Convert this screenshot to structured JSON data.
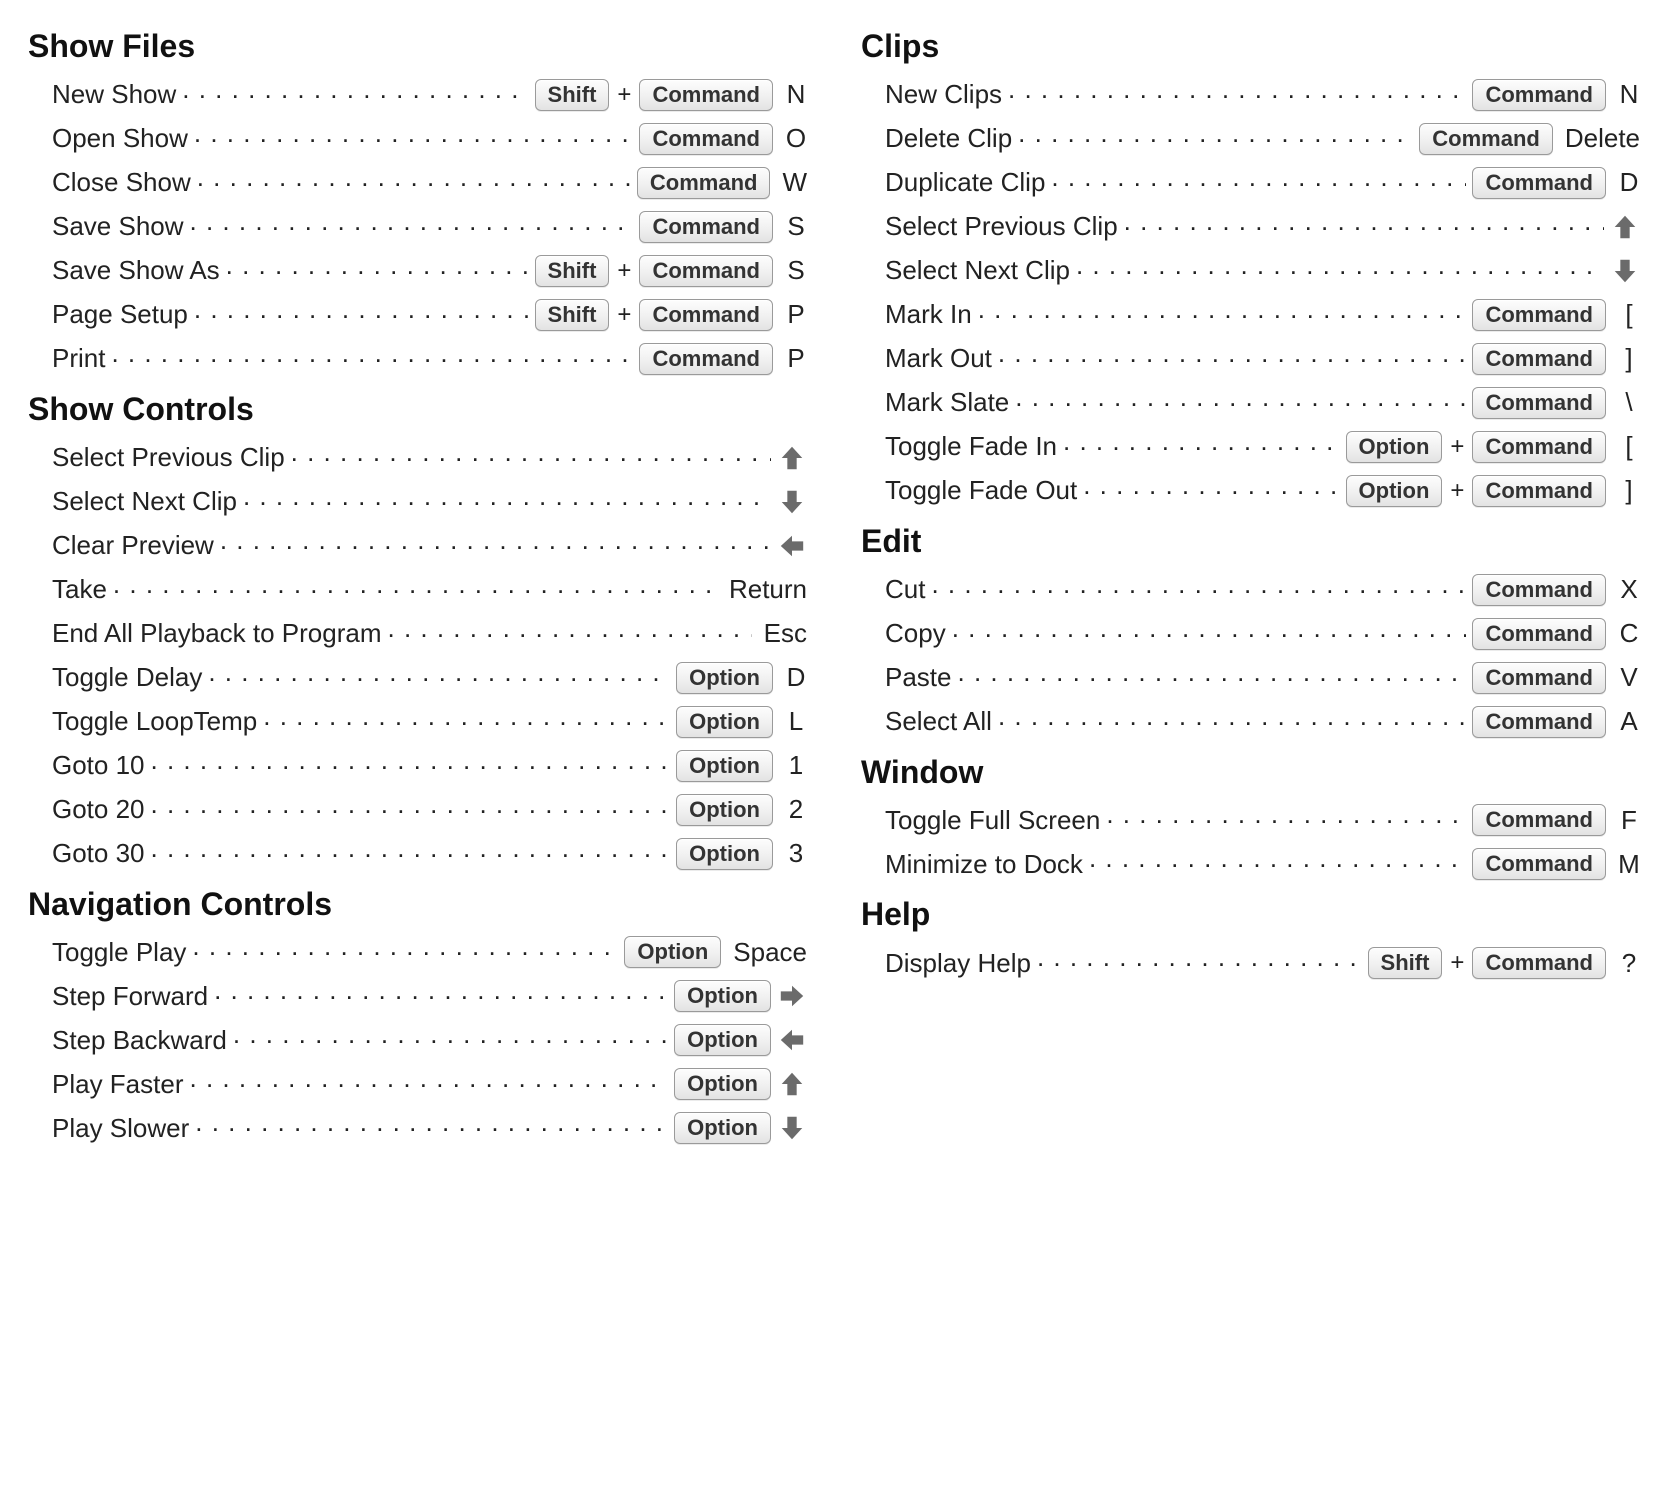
{
  "sections": [
    {
      "column": 0,
      "title": "Show Files",
      "rows": [
        {
          "label": "New Show",
          "keys": [
            {
              "t": "key",
              "v": "Shift"
            },
            {
              "t": "plus"
            },
            {
              "t": "key",
              "v": "Command"
            }
          ],
          "end": {
            "t": "text",
            "v": "N"
          }
        },
        {
          "label": "Open Show",
          "keys": [
            {
              "t": "key",
              "v": "Command"
            }
          ],
          "end": {
            "t": "text",
            "v": "O"
          }
        },
        {
          "label": "Close Show",
          "keys": [
            {
              "t": "key",
              "v": "Command"
            }
          ],
          "end": {
            "t": "text",
            "v": "W"
          }
        },
        {
          "label": "Save Show",
          "keys": [
            {
              "t": "key",
              "v": "Command"
            }
          ],
          "end": {
            "t": "text",
            "v": "S"
          }
        },
        {
          "label": "Save Show As",
          "keys": [
            {
              "t": "key",
              "v": "Shift"
            },
            {
              "t": "plus"
            },
            {
              "t": "key",
              "v": "Command"
            }
          ],
          "end": {
            "t": "text",
            "v": "S"
          }
        },
        {
          "label": "Page Setup",
          "keys": [
            {
              "t": "key",
              "v": "Shift"
            },
            {
              "t": "plus"
            },
            {
              "t": "key",
              "v": "Command"
            }
          ],
          "end": {
            "t": "text",
            "v": "P"
          }
        },
        {
          "label": "Print",
          "keys": [
            {
              "t": "key",
              "v": "Command"
            }
          ],
          "end": {
            "t": "text",
            "v": "P"
          }
        }
      ]
    },
    {
      "column": 0,
      "title": "Show Controls",
      "rows": [
        {
          "label": "Select Previous Clip",
          "keys": [],
          "end": {
            "t": "arrow",
            "v": "up"
          }
        },
        {
          "label": "Select Next Clip",
          "keys": [],
          "end": {
            "t": "arrow",
            "v": "down"
          }
        },
        {
          "label": "Clear Preview",
          "keys": [],
          "end": {
            "t": "arrow",
            "v": "left"
          }
        },
        {
          "label": "Take",
          "keys": [],
          "end": {
            "t": "text",
            "v": "Return"
          }
        },
        {
          "label": "End All Playback to Program",
          "keys": [],
          "end": {
            "t": "text",
            "v": "Esc"
          }
        },
        {
          "label": "Toggle Delay",
          "keys": [
            {
              "t": "key",
              "v": "Option"
            }
          ],
          "end": {
            "t": "text",
            "v": "D"
          }
        },
        {
          "label": "Toggle LoopTemp",
          "keys": [
            {
              "t": "key",
              "v": "Option"
            }
          ],
          "end": {
            "t": "text",
            "v": "L"
          }
        },
        {
          "label": "Goto 10",
          "keys": [
            {
              "t": "key",
              "v": "Option"
            }
          ],
          "end": {
            "t": "text",
            "v": "1"
          }
        },
        {
          "label": "Goto 20",
          "keys": [
            {
              "t": "key",
              "v": "Option"
            }
          ],
          "end": {
            "t": "text",
            "v": "2"
          }
        },
        {
          "label": "Goto 30",
          "keys": [
            {
              "t": "key",
              "v": "Option"
            }
          ],
          "end": {
            "t": "text",
            "v": "3"
          }
        }
      ]
    },
    {
      "column": 0,
      "title": "Navigation Controls",
      "rows": [
        {
          "label": "Toggle Play",
          "keys": [
            {
              "t": "key",
              "v": "Option"
            }
          ],
          "end": {
            "t": "text",
            "v": "Space"
          }
        },
        {
          "label": "Step Forward",
          "keys": [
            {
              "t": "key",
              "v": "Option"
            }
          ],
          "end": {
            "t": "arrow",
            "v": "right"
          }
        },
        {
          "label": "Step Backward",
          "keys": [
            {
              "t": "key",
              "v": "Option"
            }
          ],
          "end": {
            "t": "arrow",
            "v": "left"
          }
        },
        {
          "label": "Play Faster",
          "keys": [
            {
              "t": "key",
              "v": "Option"
            }
          ],
          "end": {
            "t": "arrow",
            "v": "up"
          }
        },
        {
          "label": "Play Slower",
          "keys": [
            {
              "t": "key",
              "v": "Option"
            }
          ],
          "end": {
            "t": "arrow",
            "v": "down"
          }
        }
      ]
    },
    {
      "column": 1,
      "title": "Clips",
      "rows": [
        {
          "label": "New Clips",
          "keys": [
            {
              "t": "key",
              "v": "Command"
            }
          ],
          "end": {
            "t": "text",
            "v": "N"
          }
        },
        {
          "label": "Delete Clip",
          "keys": [
            {
              "t": "key",
              "v": "Command"
            }
          ],
          "end": {
            "t": "text",
            "v": "Delete"
          }
        },
        {
          "label": "Duplicate Clip",
          "keys": [
            {
              "t": "key",
              "v": "Command"
            }
          ],
          "end": {
            "t": "text",
            "v": "D"
          }
        },
        {
          "label": "Select Previous Clip",
          "keys": [],
          "end": {
            "t": "arrow",
            "v": "up"
          }
        },
        {
          "label": "Select Next Clip",
          "keys": [],
          "end": {
            "t": "arrow",
            "v": "down"
          }
        },
        {
          "label": "Mark In",
          "keys": [
            {
              "t": "key",
              "v": "Command"
            }
          ],
          "end": {
            "t": "text",
            "v": "["
          }
        },
        {
          "label": "Mark Out",
          "keys": [
            {
              "t": "key",
              "v": "Command"
            }
          ],
          "end": {
            "t": "text",
            "v": "]"
          }
        },
        {
          "label": "Mark Slate",
          "keys": [
            {
              "t": "key",
              "v": "Command"
            }
          ],
          "end": {
            "t": "text",
            "v": "\\"
          }
        },
        {
          "label": "Toggle Fade In",
          "keys": [
            {
              "t": "key",
              "v": "Option"
            },
            {
              "t": "plus"
            },
            {
              "t": "key",
              "v": "Command"
            }
          ],
          "end": {
            "t": "text",
            "v": "["
          }
        },
        {
          "label": "Toggle Fade Out",
          "keys": [
            {
              "t": "key",
              "v": "Option"
            },
            {
              "t": "plus"
            },
            {
              "t": "key",
              "v": "Command"
            }
          ],
          "end": {
            "t": "text",
            "v": "]"
          }
        }
      ]
    },
    {
      "column": 1,
      "title": "Edit",
      "rows": [
        {
          "label": "Cut",
          "keys": [
            {
              "t": "key",
              "v": "Command"
            }
          ],
          "end": {
            "t": "text",
            "v": "X"
          }
        },
        {
          "label": "Copy",
          "keys": [
            {
              "t": "key",
              "v": "Command"
            }
          ],
          "end": {
            "t": "text",
            "v": "C"
          }
        },
        {
          "label": "Paste",
          "keys": [
            {
              "t": "key",
              "v": "Command"
            }
          ],
          "end": {
            "t": "text",
            "v": "V"
          }
        },
        {
          "label": "Select All",
          "keys": [
            {
              "t": "key",
              "v": "Command"
            }
          ],
          "end": {
            "t": "text",
            "v": "A"
          }
        }
      ]
    },
    {
      "column": 1,
      "title": "Window",
      "rows": [
        {
          "label": "Toggle Full Screen",
          "keys": [
            {
              "t": "key",
              "v": "Command"
            }
          ],
          "end": {
            "t": "text",
            "v": "F"
          }
        },
        {
          "label": "Minimize to Dock",
          "keys": [
            {
              "t": "key",
              "v": "Command"
            }
          ],
          "end": {
            "t": "text",
            "v": "M"
          }
        }
      ]
    },
    {
      "column": 1,
      "title": "Help",
      "rows": [
        {
          "label": "Display Help",
          "keys": [
            {
              "t": "key",
              "v": "Shift"
            },
            {
              "t": "plus"
            },
            {
              "t": "key",
              "v": "Command"
            }
          ],
          "end": {
            "t": "text",
            "v": "?"
          }
        }
      ]
    }
  ]
}
